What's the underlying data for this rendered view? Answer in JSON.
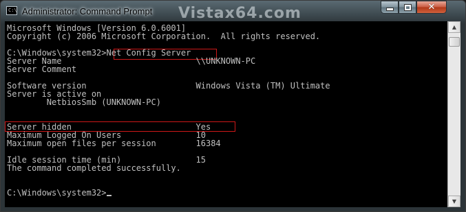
{
  "window": {
    "title": "Administrator: Command Prompt",
    "watermark": "Vistax64.com",
    "controls": {
      "minimize": "minimize",
      "maximize": "maximize",
      "close": "close"
    }
  },
  "console": {
    "lines": [
      "Microsoft Windows [Version 6.0.6001]",
      "Copyright (c) 2006 Microsoft Corporation.  All rights reserved.",
      "",
      "C:\\Windows\\system32>Net Config Server",
      "Server Name                           \\\\UNKNOWN-PC",
      "Server Comment",
      "",
      "Software version                      Windows Vista (TM) Ultimate",
      "Server is active on",
      "        NetbiosSmb (UNKNOWN-PC)",
      "",
      "",
      "Server hidden                         Yes",
      "Maximum Logged On Users               10",
      "Maximum open files per session        16384",
      "",
      "Idle session time (min)               15",
      "The command completed successfully.",
      "",
      "",
      "C:\\Windows\\system32>"
    ]
  },
  "highlights": [
    "command",
    "server-hidden-row"
  ],
  "colors": {
    "console_bg": "#000000",
    "console_text": "#c0c0c0",
    "highlight_border": "#d01818",
    "close_button": "#c85a40"
  },
  "icons": {
    "app": "command-prompt-icon",
    "scroll_up": "arrow-up-icon",
    "scroll_down": "arrow-down-icon"
  }
}
